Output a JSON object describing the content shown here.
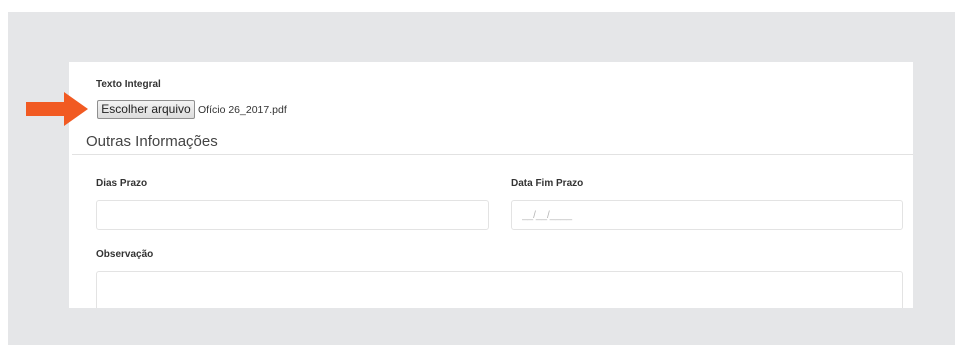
{
  "form": {
    "texto_integral_label": "Texto Integral",
    "file_button_label": "Escolher arquivo",
    "file_name": "Ofício 26_2017.pdf",
    "section_title": "Outras Informações",
    "dias_prazo_label": "Dias Prazo",
    "dias_prazo_value": "",
    "data_fim_prazo_label": "Data Fim Prazo",
    "data_fim_prazo_placeholder": "__/__/____",
    "observacao_label": "Observação",
    "observacao_value": ""
  },
  "annotation": {
    "arrow_color": "#f15a22",
    "arrow_icon": "arrow-right-icon"
  }
}
